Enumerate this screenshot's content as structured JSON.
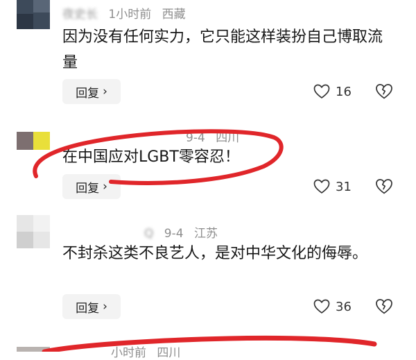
{
  "comments": [
    {
      "nickname": "夜史长",
      "time": "1小时前",
      "location": "西藏",
      "text": "因为没有任何实力，它只能这样装扮自己博取流量",
      "reply_label": "回复",
      "like_count": "16"
    },
    {
      "nickname": "",
      "time": "9-4",
      "location": "四川",
      "text": "在中国应对LGBT零容忍！",
      "reply_label": "回复",
      "like_count": "31"
    },
    {
      "nickname": "Q",
      "time": "9-4",
      "location": "江苏",
      "text": "不封杀这类不良艺人，是对中华文化的侮辱。",
      "reply_label": "回复",
      "like_count": "36"
    },
    {
      "nickname": "",
      "time": "小时前",
      "location": "四川",
      "text": "",
      "reply_label": "",
      "like_count": ""
    }
  ],
  "colors": {
    "annotation_red": "#e0262a",
    "reply_bg": "#f3f3f3",
    "meta_gray": "#8e8e8e"
  },
  "icons": {
    "like": "heart-outline-icon",
    "dislike": "broken-heart-icon",
    "reply_chevron": "chevron-right-icon"
  }
}
